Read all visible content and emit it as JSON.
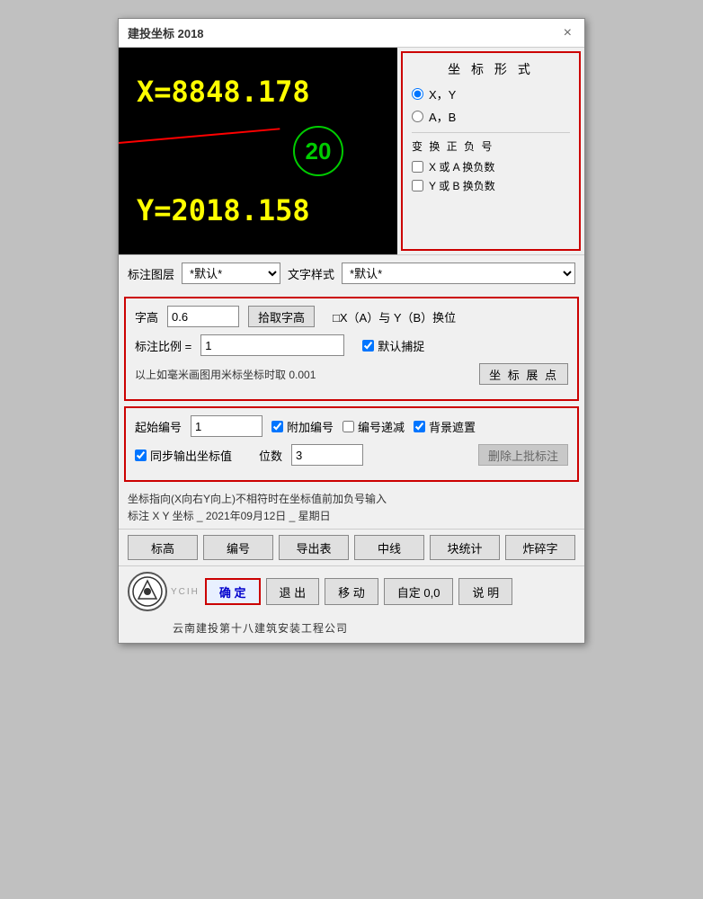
{
  "window": {
    "title": "建投坐标 2018",
    "close_label": "×"
  },
  "preview": {
    "coord_x": "X=8848.178",
    "coord_y": "Y=2018.158",
    "circle_number": "20"
  },
  "coord_format": {
    "title": "坐 标 形 式",
    "options": [
      "X，Y",
      "A，B"
    ],
    "selected": 0
  },
  "sign_convert": {
    "title": "变 换 正 负 号",
    "options": [
      "X 或 A 换负数",
      "Y 或 B 换负数"
    ]
  },
  "layer_row": {
    "layer_label": "标注图层",
    "layer_value": "*默认*",
    "style_label": "文字样式",
    "style_value": "*默认*"
  },
  "settings": {
    "font_height_label": "字高",
    "font_height_value": "0.6",
    "pick_height_btn": "拾取字高",
    "xy_swap_label": "□X（A）与 Y（B）换位",
    "scale_label": "标注比例 =",
    "scale_value": "1",
    "snap_label": "默认捕捉",
    "hint": "以上如毫米画图用米标坐标时取 0.001",
    "expand_btn": "坐 标 展 点"
  },
  "numbering": {
    "start_label": "起始编号",
    "start_value": "1",
    "add_number_label": "附加编号",
    "fade_label": "编号递减",
    "bg_mask_label": "背景遮置",
    "sync_output_label": "同步输出坐标值",
    "digits_label": "位数",
    "digits_value": "3",
    "delete_batch_btn": "删除上批标注"
  },
  "info": {
    "line1": "坐标指向(X向右Y向上)不相符时在坐标值前加负号输入",
    "line2": "标注 X Y 坐标 _ 2021年09月12日 _ 星期日"
  },
  "actions": {
    "buttons": [
      "标高",
      "编号",
      "导出表",
      "中线",
      "块统计",
      "炸碎字"
    ]
  },
  "footer": {
    "confirm_label": "确 定",
    "exit_label": "退 出",
    "move_label": "移 动",
    "auto_label": "自定 0,0",
    "help_label": "说 明",
    "company": "云南建投第十八建筑安装工程公司"
  }
}
